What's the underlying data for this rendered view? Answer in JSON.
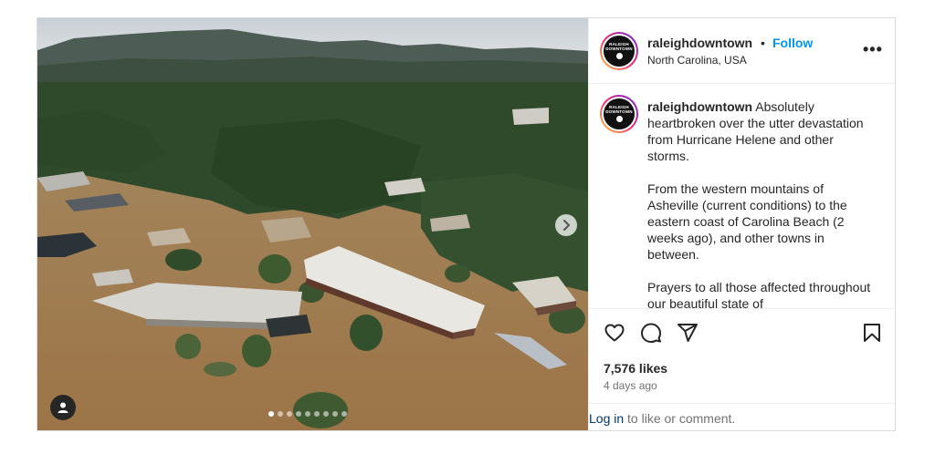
{
  "post": {
    "username": "raleighdowntown",
    "separator": "•",
    "follow_label": "Follow",
    "location": "North Carolina, USA",
    "more_label": "•••",
    "avatar_text_line1": "RALEIGH",
    "avatar_text_line2": "DOWNTOWN",
    "caption_username": "raleighdowntown",
    "caption_paragraph1": "Absolutely heartbroken over the utter devastation from Hurricane Helene and other storms.",
    "caption_paragraph2": "From the western mountains of Asheville (current conditions) to the eastern coast of Carolina Beach (2 weeks ago), and other towns in between.",
    "caption_paragraph3": "Prayers to all those affected throughout our beautiful state of",
    "likes": "7,576 likes",
    "time_ago": "4 days ago",
    "login_link": "Log in",
    "login_rest": " to like or comment."
  },
  "media": {
    "carousel_count": 9,
    "carousel_active_index": 0,
    "next_icon": "chevron-right-icon",
    "user_tag_icon": "person-icon"
  },
  "colors": {
    "follow": "#0095f6",
    "link": "#00376b",
    "muted": "#737373",
    "border": "#dbdbdb",
    "flood_water": "#a9814f"
  }
}
